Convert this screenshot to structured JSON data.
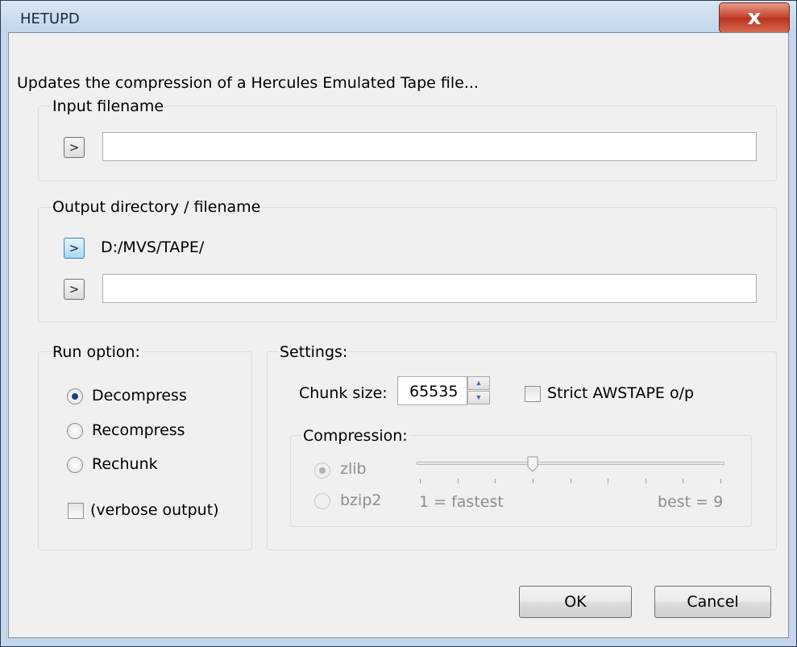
{
  "window": {
    "title": "HETUPD",
    "close_glyph": "x"
  },
  "description": "Updates the compression of a Hercules Emulated Tape file...",
  "input": {
    "group_label": "Input filename",
    "browse_label": ">",
    "value": ""
  },
  "output": {
    "group_label": "Output directory / filename",
    "dir_browse_label": ">",
    "directory": "D:/MVS/TAPE/",
    "file_browse_label": ">",
    "value": ""
  },
  "run_option": {
    "group_label": "Run option:",
    "options": [
      {
        "label": "Decompress",
        "selected": true
      },
      {
        "label": "Recompress",
        "selected": false
      },
      {
        "label": "Rechunk",
        "selected": false
      }
    ],
    "verbose_label": "(verbose output)",
    "verbose_checked": false
  },
  "settings": {
    "group_label": "Settings:",
    "chunk_label": "Chunk size:",
    "chunk_value": "65535",
    "strict_label": "Strict AWSTAPE o/p",
    "strict_checked": false,
    "compression": {
      "group_label": "Compression:",
      "zlib_label": "zlib",
      "bzip2_label": "bzip2",
      "selected": "zlib",
      "level": 4,
      "min_label": "1 = fastest",
      "max_label": "best = 9"
    }
  },
  "buttons": {
    "ok": "OK",
    "cancel": "Cancel"
  }
}
